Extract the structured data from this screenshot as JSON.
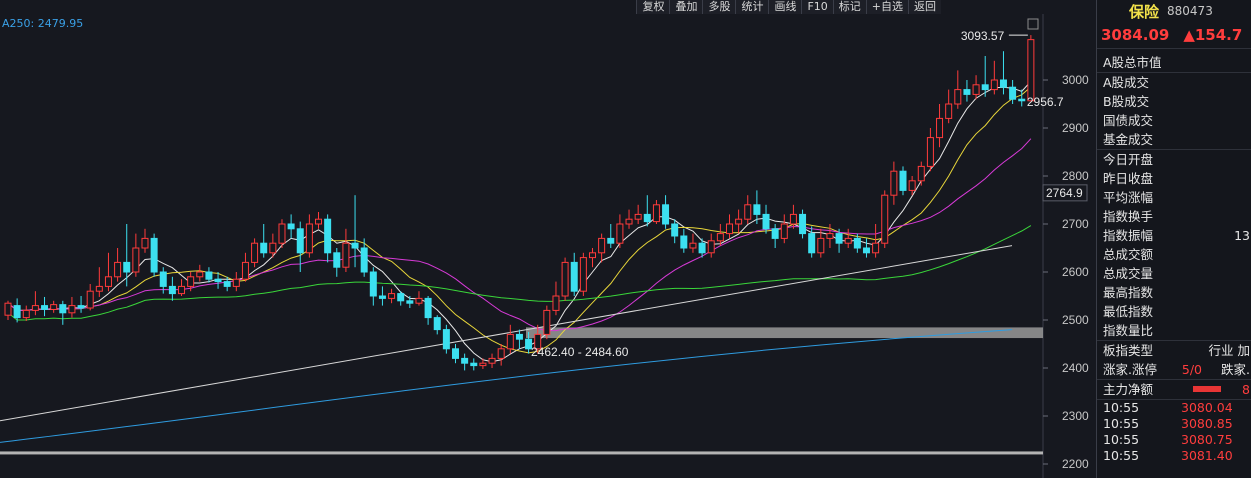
{
  "toolbar": {
    "buttons": [
      "复权",
      "叠加",
      "多股",
      "统计",
      "画线",
      "F10",
      "标记",
      "+自选",
      "返回"
    ]
  },
  "indicator_label": "A250: 2479.95",
  "chart_data": {
    "type": "candlestick",
    "y_axis": {
      "ticks": [
        2200,
        2300,
        2400,
        2500,
        2600,
        2700,
        2800,
        2900,
        3000
      ],
      "range": [
        2180,
        3100
      ]
    },
    "annotations": {
      "high_label": "3093.57",
      "low_label": "2956.7",
      "price_tag": "2764.9",
      "zone_label": "2462.40 - 2484.60"
    },
    "zone": {
      "low": 2462.4,
      "high": 2484.6
    },
    "support_line": 2222,
    "candles": [
      [
        2510,
        2535,
        2500,
        2540
      ],
      [
        2530,
        2505,
        2495,
        2545
      ],
      [
        2505,
        2520,
        2498,
        2530
      ],
      [
        2520,
        2530,
        2510,
        2560
      ],
      [
        2530,
        2522,
        2508,
        2548
      ],
      [
        2522,
        2532,
        2515,
        2540
      ],
      [
        2532,
        2515,
        2490,
        2540
      ],
      [
        2515,
        2530,
        2505,
        2548
      ],
      [
        2530,
        2525,
        2515,
        2550
      ],
      [
        2525,
        2560,
        2520,
        2575
      ],
      [
        2560,
        2570,
        2548,
        2610
      ],
      [
        2570,
        2590,
        2560,
        2640
      ],
      [
        2590,
        2620,
        2580,
        2650
      ],
      [
        2620,
        2600,
        2570,
        2700
      ],
      [
        2600,
        2650,
        2590,
        2680
      ],
      [
        2650,
        2670,
        2640,
        2690
      ],
      [
        2670,
        2600,
        2590,
        2680
      ],
      [
        2600,
        2570,
        2555,
        2610
      ],
      [
        2570,
        2555,
        2540,
        2590
      ],
      [
        2555,
        2570,
        2550,
        2585
      ],
      [
        2570,
        2590,
        2560,
        2600
      ],
      [
        2590,
        2600,
        2580,
        2615
      ],
      [
        2600,
        2585,
        2578,
        2610
      ],
      [
        2585,
        2580,
        2565,
        2600
      ],
      [
        2580,
        2570,
        2560,
        2590
      ],
      [
        2570,
        2585,
        2560,
        2600
      ],
      [
        2585,
        2620,
        2580,
        2640
      ],
      [
        2620,
        2660,
        2610,
        2670
      ],
      [
        2660,
        2640,
        2630,
        2700
      ],
      [
        2640,
        2660,
        2630,
        2680
      ],
      [
        2660,
        2700,
        2650,
        2710
      ],
      [
        2700,
        2690,
        2670,
        2720
      ],
      [
        2690,
        2640,
        2600,
        2705
      ],
      [
        2640,
        2700,
        2630,
        2720
      ],
      [
        2700,
        2710,
        2690,
        2725
      ],
      [
        2710,
        2640,
        2620,
        2720
      ],
      [
        2640,
        2610,
        2590,
        2650
      ],
      [
        2610,
        2660,
        2600,
        2690
      ],
      [
        2660,
        2650,
        2610,
        2760
      ],
      [
        2650,
        2600,
        2590,
        2670
      ],
      [
        2600,
        2550,
        2530,
        2610
      ],
      [
        2550,
        2545,
        2530,
        2570
      ],
      [
        2545,
        2555,
        2535,
        2565
      ],
      [
        2555,
        2540,
        2530,
        2560
      ],
      [
        2540,
        2535,
        2525,
        2550
      ],
      [
        2535,
        2545,
        2530,
        2560
      ],
      [
        2545,
        2505,
        2490,
        2550
      ],
      [
        2505,
        2480,
        2470,
        2510
      ],
      [
        2480,
        2440,
        2430,
        2490
      ],
      [
        2440,
        2420,
        2410,
        2450
      ],
      [
        2420,
        2410,
        2395,
        2430
      ],
      [
        2410,
        2405,
        2395,
        2420
      ],
      [
        2405,
        2410,
        2398,
        2420
      ],
      [
        2410,
        2420,
        2400,
        2430
      ],
      [
        2420,
        2440,
        2405,
        2450
      ],
      [
        2440,
        2470,
        2430,
        2490
      ],
      [
        2470,
        2460,
        2440,
        2480
      ],
      [
        2460,
        2440,
        2430,
        2475
      ],
      [
        2440,
        2470,
        2430,
        2490
      ],
      [
        2470,
        2520,
        2460,
        2530
      ],
      [
        2520,
        2550,
        2510,
        2580
      ],
      [
        2550,
        2620,
        2540,
        2630
      ],
      [
        2620,
        2560,
        2550,
        2640
      ],
      [
        2560,
        2630,
        2550,
        2640
      ],
      [
        2630,
        2640,
        2610,
        2650
      ],
      [
        2640,
        2670,
        2620,
        2680
      ],
      [
        2670,
        2660,
        2650,
        2700
      ],
      [
        2660,
        2700,
        2650,
        2720
      ],
      [
        2700,
        2710,
        2690,
        2730
      ],
      [
        2710,
        2720,
        2700,
        2740
      ],
      [
        2720,
        2705,
        2695,
        2760
      ],
      [
        2705,
        2740,
        2700,
        2750
      ],
      [
        2740,
        2700,
        2690,
        2760
      ],
      [
        2700,
        2675,
        2660,
        2710
      ],
      [
        2675,
        2650,
        2640,
        2690
      ],
      [
        2650,
        2660,
        2640,
        2680
      ],
      [
        2660,
        2640,
        2630,
        2670
      ],
      [
        2640,
        2665,
        2630,
        2680
      ],
      [
        2665,
        2680,
        2655,
        2700
      ],
      [
        2680,
        2700,
        2670,
        2720
      ],
      [
        2700,
        2710,
        2680,
        2730
      ],
      [
        2710,
        2740,
        2700,
        2760
      ],
      [
        2740,
        2720,
        2700,
        2770
      ],
      [
        2720,
        2690,
        2680,
        2740
      ],
      [
        2690,
        2670,
        2650,
        2700
      ],
      [
        2670,
        2700,
        2660,
        2720
      ],
      [
        2700,
        2720,
        2690,
        2740
      ],
      [
        2720,
        2680,
        2670,
        2730
      ],
      [
        2680,
        2640,
        2630,
        2695
      ],
      [
        2640,
        2670,
        2630,
        2690
      ],
      [
        2670,
        2680,
        2650,
        2700
      ],
      [
        2680,
        2660,
        2640,
        2690
      ],
      [
        2660,
        2670,
        2650,
        2690
      ],
      [
        2670,
        2650,
        2640,
        2680
      ],
      [
        2650,
        2640,
        2630,
        2670
      ],
      [
        2640,
        2660,
        2630,
        2700
      ],
      [
        2660,
        2760,
        2650,
        2770
      ],
      [
        2760,
        2810,
        2740,
        2830
      ],
      [
        2810,
        2770,
        2760,
        2820
      ],
      [
        2770,
        2790,
        2760,
        2800
      ],
      [
        2790,
        2820,
        2780,
        2830
      ],
      [
        2820,
        2880,
        2810,
        2900
      ],
      [
        2880,
        2920,
        2860,
        2950
      ],
      [
        2920,
        2950,
        2910,
        2980
      ],
      [
        2950,
        2980,
        2940,
        3020
      ],
      [
        2980,
        2970,
        2955,
        3000
      ],
      [
        2970,
        2990,
        2960,
        3010
      ],
      [
        2990,
        2980,
        2965,
        3050
      ],
      [
        2980,
        3000,
        2970,
        3040
      ],
      [
        3000,
        2985,
        2970,
        3060
      ],
      [
        2985,
        2960,
        2950,
        3000
      ],
      [
        2960,
        2956.7,
        2945,
        2980
      ],
      [
        2956.7,
        3084.09,
        2955,
        3093.57
      ]
    ]
  },
  "sidebar": {
    "name": "保险",
    "code": "880473",
    "price": "3084.09",
    "change": "▲154.7",
    "rows": [
      "A股总市值",
      "A股成交",
      "B股成交",
      "国债成交",
      "基金成交",
      "今日开盘",
      "昨日收盘",
      "平均涨幅",
      "指数换手",
      "指数振幅",
      "总成交额",
      "总成交量",
      "最高指数",
      "最低指数",
      "指数量比",
      "板指类型",
      "涨家.涨停",
      "主力净额"
    ],
    "amplitude_value": "13",
    "index_type_value": "行业 加",
    "up_limit_value": "5/0",
    "down_label": "跌家.",
    "net_value": "8",
    "ticks": [
      {
        "time": "10:55",
        "price": "3080.04"
      },
      {
        "time": "10:55",
        "price": "3080.85"
      },
      {
        "time": "10:55",
        "price": "3080.75"
      },
      {
        "time": "10:55",
        "price": "3081.40"
      }
    ]
  }
}
